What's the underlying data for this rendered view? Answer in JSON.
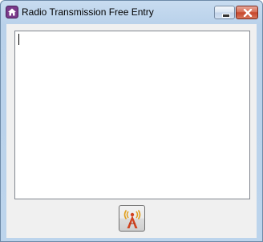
{
  "window": {
    "title": "Radio Transmission Free Entry",
    "minimize_icon": "minimize-icon",
    "close_icon": "close-icon"
  },
  "editor": {
    "value": ""
  },
  "actions": {
    "transmit_icon": "radio-tower-icon"
  },
  "colors": {
    "title_bar": "#b9d1ea",
    "client_bg": "#f0f0f0",
    "close_button": "#c7472c",
    "tower": "#d2431f",
    "waves": "#e0a020"
  }
}
